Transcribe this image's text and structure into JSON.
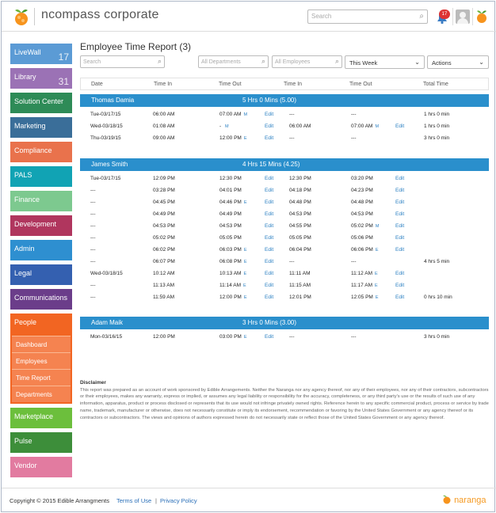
{
  "header": {
    "brand": "ncompass corporate",
    "search_placeholder": "Search",
    "notif_count": "17"
  },
  "sidebar": {
    "items": [
      {
        "label": "LiveWall",
        "count": "17",
        "color": "#5b9bd5"
      },
      {
        "label": "Library",
        "count": "31",
        "color": "#9b72b5"
      },
      {
        "label": "Solution Center",
        "count": "",
        "color": "#2e8b57"
      },
      {
        "label": "Marketing",
        "count": "",
        "color": "#3a6e99"
      },
      {
        "label": "Compliance",
        "count": "",
        "color": "#e9724c"
      },
      {
        "label": "PALS",
        "count": "",
        "color": "#11a3b4"
      },
      {
        "label": "Finance",
        "count": "",
        "color": "#7dc98f"
      },
      {
        "label": "Development",
        "count": "",
        "color": "#b0365e"
      },
      {
        "label": "Admin",
        "count": "",
        "color": "#2e8fd0"
      },
      {
        "label": "Legal",
        "count": "",
        "color": "#3460b0"
      },
      {
        "label": "Communications",
        "count": "",
        "color": "#6b3d8a"
      }
    ],
    "people": {
      "label": "People",
      "subs": [
        "Dashboard",
        "Employees",
        "Time Report",
        "Departments"
      ]
    },
    "after": [
      {
        "label": "Marketplace",
        "color": "#6cbf3c"
      },
      {
        "label": "Pulse",
        "color": "#3d8e3a"
      },
      {
        "label": "Vendor",
        "color": "#e27ba0"
      }
    ]
  },
  "main": {
    "title": "Employee Time Report (3)",
    "search_placeholder": "Search",
    "dept_placeholder": "All Departments",
    "emp_placeholder": "All Employees",
    "period": "This Week",
    "actions": "Actions",
    "columns": [
      "Date",
      "Time In",
      "Time Out",
      "Time In",
      "Time Out",
      "Total Time"
    ],
    "edit_label": "Edit",
    "groups": [
      {
        "name": "Thomas Damia",
        "total": "5 Hrs 0 Mins (5.00)",
        "rows": [
          {
            "date": "Tue-03/17/15",
            "in1": "06:00 AM",
            "out1": "07:00 AM",
            "out1_tag": "M",
            "in2": "---",
            "out2": "---",
            "out2_tag": "",
            "edit2": false,
            "total": "1 hrs 0 min"
          },
          {
            "date": "Wed-03/18/15",
            "in1": "01:08 AM",
            "out1": "- ",
            "out1_tag": "M",
            "in2": "06:00 AM",
            "out2": "07:00 AM",
            "out2_tag": "M",
            "edit2": true,
            "total": "1 hrs 0 min"
          },
          {
            "date": "Thu-03/19/15",
            "in1": "09:00 AM",
            "out1": "12:00 PM",
            "out1_tag": "E",
            "in2": "---",
            "out2": "---",
            "out2_tag": "",
            "edit2": false,
            "total": "3 hrs 0 min"
          }
        ]
      },
      {
        "name": "James Smith",
        "total": "4 Hrs 15 Mins (4.25)",
        "rows": [
          {
            "date": "Tue-03/17/15",
            "in1": "12:09 PM",
            "out1": "12:30 PM",
            "out1_tag": "",
            "in2": "12:30 PM",
            "out2": "03:20 PM",
            "out2_tag": "",
            "edit2": true,
            "total": ""
          },
          {
            "date": "---",
            "in1": "03:28 PM",
            "out1": "04:01 PM",
            "out1_tag": "",
            "in2": "04:18 PM",
            "out2": "04:23 PM",
            "out2_tag": "",
            "edit2": true,
            "total": ""
          },
          {
            "date": "---",
            "in1": "04:45 PM",
            "out1": "04:46 PM",
            "out1_tag": "E",
            "in2": "04:48 PM",
            "out2": "04:48 PM",
            "out2_tag": "",
            "edit2": true,
            "total": ""
          },
          {
            "date": "---",
            "in1": "04:49 PM",
            "out1": "04:49 PM",
            "out1_tag": "",
            "in2": "04:53 PM",
            "out2": "04:53 PM",
            "out2_tag": "",
            "edit2": true,
            "total": ""
          },
          {
            "date": "---",
            "in1": "04:53 PM",
            "out1": "04:53 PM",
            "out1_tag": "",
            "in2": "04:55 PM",
            "out2": "05:02 PM",
            "out2_tag": "M",
            "edit2": true,
            "total": ""
          },
          {
            "date": "---",
            "in1": "05:02 PM",
            "out1": "05:05 PM",
            "out1_tag": "",
            "in2": "05:05 PM",
            "out2": "05:06 PM",
            "out2_tag": "",
            "edit2": true,
            "total": ""
          },
          {
            "date": "---",
            "in1": "06:02 PM",
            "out1": "06:03 PM",
            "out1_tag": "E",
            "in2": "06:04 PM",
            "out2": "06:06 PM",
            "out2_tag": "E",
            "edit2": true,
            "total": ""
          },
          {
            "date": "---",
            "in1": "06:07 PM",
            "out1": "06:08 PM",
            "out1_tag": "E",
            "in2": "---",
            "out2": "---",
            "out2_tag": "",
            "edit2": false,
            "total": "4 hrs 5 min"
          },
          {
            "date": "Wed-03/18/15",
            "in1": "10:12 AM",
            "out1": "10:13 AM",
            "out1_tag": "E",
            "in2": "11:11 AM",
            "out2": "11:12 AM",
            "out2_tag": "E",
            "edit2": true,
            "total": ""
          },
          {
            "date": "---",
            "in1": "11:13 AM",
            "out1": "11:14 AM",
            "out1_tag": "E",
            "in2": "11:15 AM",
            "out2": "11:17 AM",
            "out2_tag": "E",
            "edit2": true,
            "total": ""
          },
          {
            "date": "---",
            "in1": "11:59 AM",
            "out1": "12:00 PM",
            "out1_tag": "E",
            "in2": "12:01 PM",
            "out2": "12:05 PM",
            "out2_tag": "E",
            "edit2": true,
            "total": "0 hrs 10 min"
          }
        ]
      },
      {
        "name": "Adam Maik",
        "total": "3 Hrs 0 Mins (3.00)",
        "rows": [
          {
            "date": "Mon-03/16/15",
            "in1": "12:00 PM",
            "out1": "03:00 PM",
            "out1_tag": "E",
            "in2": "---",
            "out2": "---",
            "out2_tag": "",
            "edit2": false,
            "total": "3 hrs 0 min"
          }
        ]
      }
    ]
  },
  "disclaimer": {
    "heading": "Disclaimer",
    "text": "This report was prepared as an account of work sponsored by Edible Arrangements. Neither the Naranga nor any agency thereof, nor any of their employees, nor any of their contractors, subcontractors or their employees, makes any warranty, express or implied, or assumes any legal liability or responsibility for the accuracy, completeness, or any third party's use or the results of such use of any information, apparatus, product or process disclosed or represents that its use would not infringe privately owned rights. Reference herein to any specific commercial product, process or service by trade name, trademark, manufacturer or otherwise, does not necessarily constitute or imply its endorsement, recommendation or favoring by the United States Government or any agency thereof or its contractors or subcontractors. The views and opinions of authors expressed herein do not necessarily state or reflect those of the United States Government or any agency thereof."
  },
  "footer": {
    "copyright": "Copyright © 2015 Edible Arrangments",
    "terms": "Terms of Use",
    "sep": "|",
    "privacy": "Privacy Policy",
    "brand": "naranga"
  }
}
